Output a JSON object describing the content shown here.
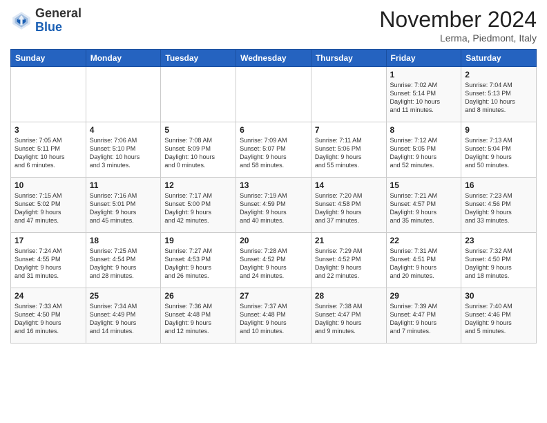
{
  "header": {
    "logo_line1": "General",
    "logo_line2": "Blue",
    "month": "November 2024",
    "location": "Lerma, Piedmont, Italy"
  },
  "weekdays": [
    "Sunday",
    "Monday",
    "Tuesday",
    "Wednesday",
    "Thursday",
    "Friday",
    "Saturday"
  ],
  "weeks": [
    [
      {
        "day": "",
        "info": ""
      },
      {
        "day": "",
        "info": ""
      },
      {
        "day": "",
        "info": ""
      },
      {
        "day": "",
        "info": ""
      },
      {
        "day": "",
        "info": ""
      },
      {
        "day": "1",
        "info": "Sunrise: 7:02 AM\nSunset: 5:14 PM\nDaylight: 10 hours\nand 11 minutes."
      },
      {
        "day": "2",
        "info": "Sunrise: 7:04 AM\nSunset: 5:13 PM\nDaylight: 10 hours\nand 8 minutes."
      }
    ],
    [
      {
        "day": "3",
        "info": "Sunrise: 7:05 AM\nSunset: 5:11 PM\nDaylight: 10 hours\nand 6 minutes."
      },
      {
        "day": "4",
        "info": "Sunrise: 7:06 AM\nSunset: 5:10 PM\nDaylight: 10 hours\nand 3 minutes."
      },
      {
        "day": "5",
        "info": "Sunrise: 7:08 AM\nSunset: 5:09 PM\nDaylight: 10 hours\nand 0 minutes."
      },
      {
        "day": "6",
        "info": "Sunrise: 7:09 AM\nSunset: 5:07 PM\nDaylight: 9 hours\nand 58 minutes."
      },
      {
        "day": "7",
        "info": "Sunrise: 7:11 AM\nSunset: 5:06 PM\nDaylight: 9 hours\nand 55 minutes."
      },
      {
        "day": "8",
        "info": "Sunrise: 7:12 AM\nSunset: 5:05 PM\nDaylight: 9 hours\nand 52 minutes."
      },
      {
        "day": "9",
        "info": "Sunrise: 7:13 AM\nSunset: 5:04 PM\nDaylight: 9 hours\nand 50 minutes."
      }
    ],
    [
      {
        "day": "10",
        "info": "Sunrise: 7:15 AM\nSunset: 5:02 PM\nDaylight: 9 hours\nand 47 minutes."
      },
      {
        "day": "11",
        "info": "Sunrise: 7:16 AM\nSunset: 5:01 PM\nDaylight: 9 hours\nand 45 minutes."
      },
      {
        "day": "12",
        "info": "Sunrise: 7:17 AM\nSunset: 5:00 PM\nDaylight: 9 hours\nand 42 minutes."
      },
      {
        "day": "13",
        "info": "Sunrise: 7:19 AM\nSunset: 4:59 PM\nDaylight: 9 hours\nand 40 minutes."
      },
      {
        "day": "14",
        "info": "Sunrise: 7:20 AM\nSunset: 4:58 PM\nDaylight: 9 hours\nand 37 minutes."
      },
      {
        "day": "15",
        "info": "Sunrise: 7:21 AM\nSunset: 4:57 PM\nDaylight: 9 hours\nand 35 minutes."
      },
      {
        "day": "16",
        "info": "Sunrise: 7:23 AM\nSunset: 4:56 PM\nDaylight: 9 hours\nand 33 minutes."
      }
    ],
    [
      {
        "day": "17",
        "info": "Sunrise: 7:24 AM\nSunset: 4:55 PM\nDaylight: 9 hours\nand 31 minutes."
      },
      {
        "day": "18",
        "info": "Sunrise: 7:25 AM\nSunset: 4:54 PM\nDaylight: 9 hours\nand 28 minutes."
      },
      {
        "day": "19",
        "info": "Sunrise: 7:27 AM\nSunset: 4:53 PM\nDaylight: 9 hours\nand 26 minutes."
      },
      {
        "day": "20",
        "info": "Sunrise: 7:28 AM\nSunset: 4:52 PM\nDaylight: 9 hours\nand 24 minutes."
      },
      {
        "day": "21",
        "info": "Sunrise: 7:29 AM\nSunset: 4:52 PM\nDaylight: 9 hours\nand 22 minutes."
      },
      {
        "day": "22",
        "info": "Sunrise: 7:31 AM\nSunset: 4:51 PM\nDaylight: 9 hours\nand 20 minutes."
      },
      {
        "day": "23",
        "info": "Sunrise: 7:32 AM\nSunset: 4:50 PM\nDaylight: 9 hours\nand 18 minutes."
      }
    ],
    [
      {
        "day": "24",
        "info": "Sunrise: 7:33 AM\nSunset: 4:50 PM\nDaylight: 9 hours\nand 16 minutes."
      },
      {
        "day": "25",
        "info": "Sunrise: 7:34 AM\nSunset: 4:49 PM\nDaylight: 9 hours\nand 14 minutes."
      },
      {
        "day": "26",
        "info": "Sunrise: 7:36 AM\nSunset: 4:48 PM\nDaylight: 9 hours\nand 12 minutes."
      },
      {
        "day": "27",
        "info": "Sunrise: 7:37 AM\nSunset: 4:48 PM\nDaylight: 9 hours\nand 10 minutes."
      },
      {
        "day": "28",
        "info": "Sunrise: 7:38 AM\nSunset: 4:47 PM\nDaylight: 9 hours\nand 9 minutes."
      },
      {
        "day": "29",
        "info": "Sunrise: 7:39 AM\nSunset: 4:47 PM\nDaylight: 9 hours\nand 7 minutes."
      },
      {
        "day": "30",
        "info": "Sunrise: 7:40 AM\nSunset: 4:46 PM\nDaylight: 9 hours\nand 5 minutes."
      }
    ]
  ]
}
